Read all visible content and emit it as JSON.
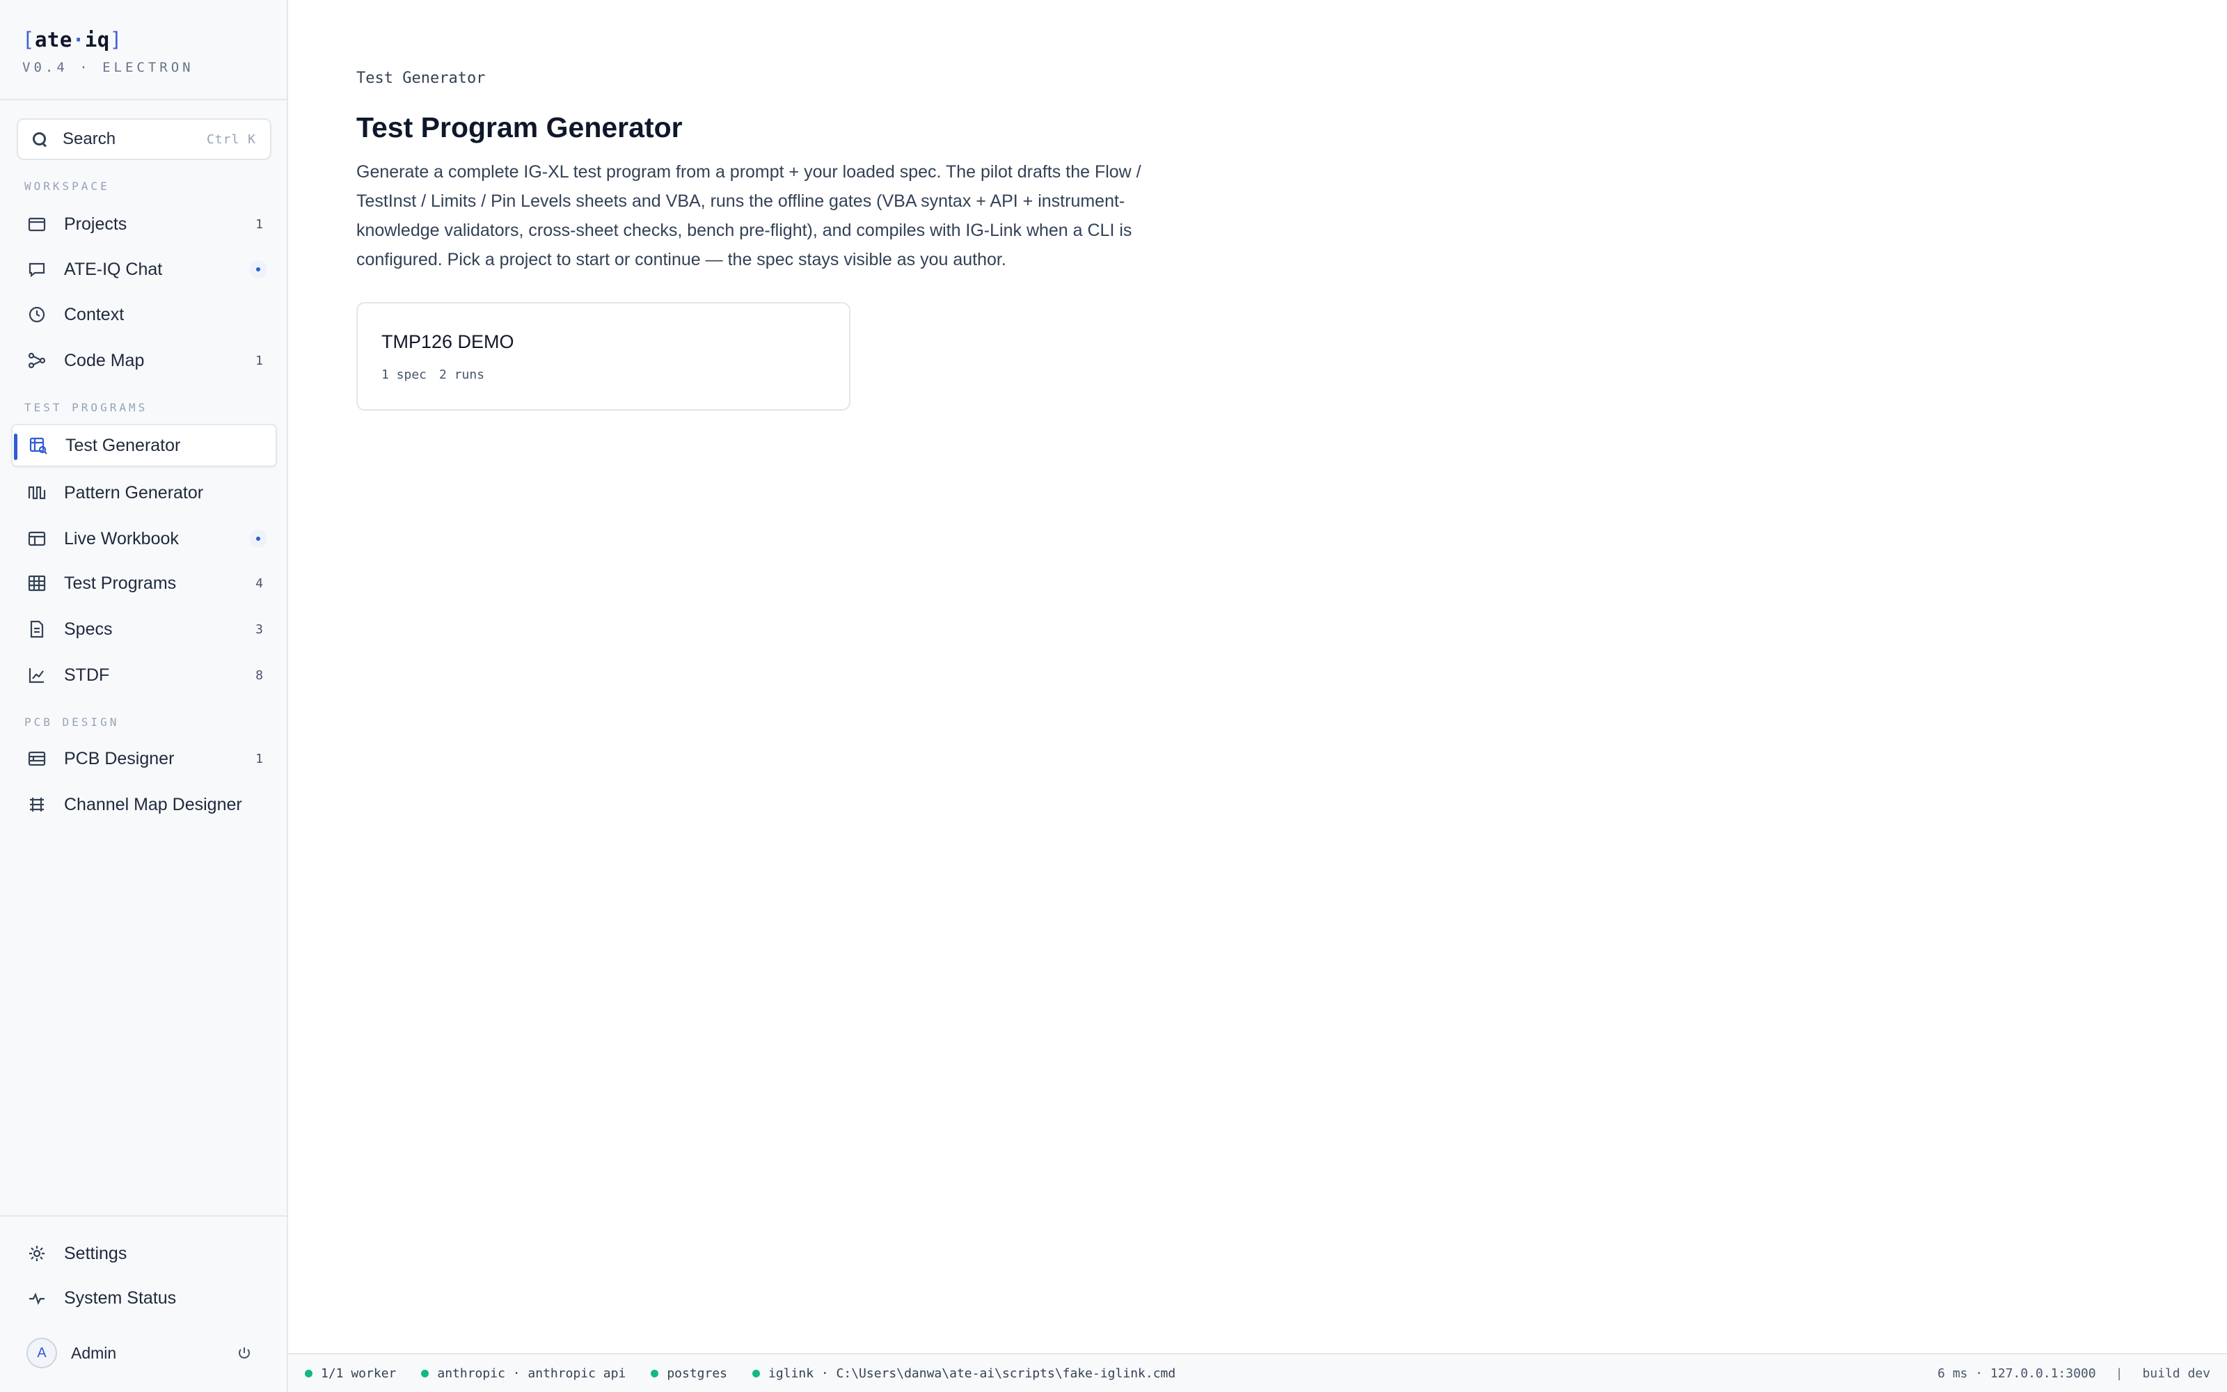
{
  "brand": {
    "logo_open": "[",
    "logo_a": "ate",
    "logo_dot": "·",
    "logo_b": "iq",
    "logo_close": "]",
    "version": "V0.4 · ELECTRON"
  },
  "search": {
    "label": "Search",
    "shortcut": "Ctrl K"
  },
  "sections": {
    "workspace": "WORKSPACE",
    "test_programs": "TEST PROGRAMS",
    "pcb_design": "PCB DESIGN"
  },
  "nav": {
    "projects": {
      "label": "Projects",
      "badge": "1",
      "icon": "folder-icon"
    },
    "chat": {
      "label": "ATE-IQ Chat",
      "icon": "chat-icon"
    },
    "context": {
      "label": "Context",
      "icon": "clock-icon"
    },
    "code_map": {
      "label": "Code Map",
      "badge": "1",
      "icon": "graph-icon"
    },
    "test_generator": {
      "label": "Test Generator",
      "icon": "table-search-icon"
    },
    "pattern_generator": {
      "label": "Pattern Generator",
      "icon": "waveform-icon"
    },
    "live_workbook": {
      "label": "Live Workbook",
      "icon": "workbook-icon"
    },
    "test_programs": {
      "label": "Test Programs",
      "badge": "4",
      "icon": "grid-icon"
    },
    "specs": {
      "label": "Specs",
      "badge": "3",
      "icon": "document-icon"
    },
    "stdf": {
      "label": "STDF",
      "badge": "8",
      "icon": "line-chart-icon"
    },
    "pcb_designer": {
      "label": "PCB Designer",
      "badge": "1",
      "icon": "board-icon"
    },
    "channel_map": {
      "label": "Channel Map Designer",
      "icon": "channel-map-icon"
    },
    "settings": {
      "label": "Settings",
      "icon": "gear-icon"
    },
    "system_status": {
      "label": "System Status",
      "icon": "pulse-icon"
    }
  },
  "user": {
    "initial": "A",
    "name": "Admin"
  },
  "main": {
    "breadcrumb": "Test Generator",
    "title": "Test Program Generator",
    "description": "Generate a complete IG-XL test program from a prompt + your loaded spec. The pilot drafts the Flow / TestInst / Limits / Pin Levels sheets and VBA, runs the offline gates (VBA syntax + API + instrument-knowledge validators, cross-sheet checks, bench pre-flight), and compiles with IG-Link when a CLI is configured. Pick a project to start or continue — the spec stays visible as you author.",
    "projects": [
      {
        "name": "TMP126 DEMO",
        "specs": "1 spec",
        "runs": "2 runs"
      }
    ]
  },
  "statusbar": {
    "workers": "1/1 worker",
    "anthropic": "anthropic · anthropic api",
    "postgres": "postgres",
    "iglink": "iglink · C:\\Users\\danwa\\ate-ai\\scripts\\fake-iglink.cmd",
    "latency": "6 ms · 127.0.0.1:3000",
    "separator": "|",
    "build": "build dev",
    "ok_color": "#10b981"
  },
  "colors": {
    "accent": "#2f5bd3",
    "text": "#0f172a",
    "muted": "#94a3b8"
  }
}
